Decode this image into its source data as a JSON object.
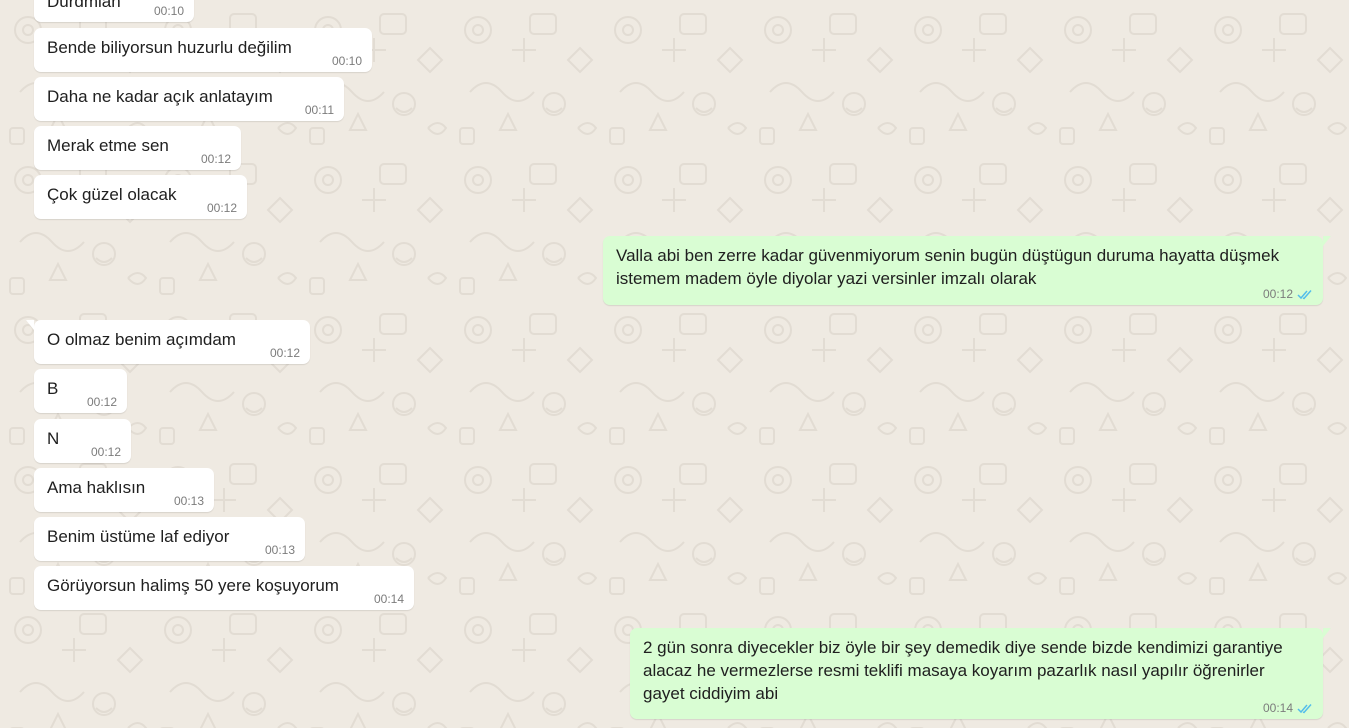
{
  "colors": {
    "background": "#efeae2",
    "incoming_bubble": "#ffffff",
    "outgoing_bubble": "#d9fdd3",
    "read_ticks": "#53bdeb"
  },
  "messages": [
    {
      "direction": "in",
      "text": "Durdmlah",
      "time": "00:10"
    },
    {
      "direction": "in",
      "text": "Bende biliyorsun huzurlu değilim",
      "time": "00:10"
    },
    {
      "direction": "in",
      "text": "Daha ne kadar açık anlatayım",
      "time": "00:11"
    },
    {
      "direction": "in",
      "text": "Merak etme sen",
      "time": "00:12"
    },
    {
      "direction": "in",
      "text": "Çok güzel olacak",
      "time": "00:12"
    },
    {
      "direction": "out",
      "lines": [
        "Valla abi ben zerre kadar güvenmiyorum senin bugün düştügun duruma hayatta düşmek",
        "istemem madem öyle diyolar yazi versinler imzalı olarak"
      ],
      "time": "00:12",
      "status_icon": "double-check-read"
    },
    {
      "direction": "in",
      "text": "O olmaz benim açımdam",
      "time": "00:12"
    },
    {
      "direction": "in",
      "text": "B",
      "time": "00:12"
    },
    {
      "direction": "in",
      "text": "N",
      "time": "00:12"
    },
    {
      "direction": "in",
      "text": "Ama haklısın",
      "time": "00:13"
    },
    {
      "direction": "in",
      "text": "Benim üstüme laf ediyor",
      "time": "00:13"
    },
    {
      "direction": "in",
      "text": "Görüyorsun halimş 50 yere koşuyorum",
      "time": "00:14"
    },
    {
      "direction": "out",
      "lines": [
        "2 gün sonra diyecekler biz öyle bir şey demedik diye sende bizde kendimizi garantiye",
        "alacaz he vermezlerse resmi teklifi masaya koyarım pazarlık nasıl yapılır öğrenirler",
        "gayet ciddiyim abi"
      ],
      "time": "00:14",
      "status_icon": "double-check-read"
    }
  ]
}
